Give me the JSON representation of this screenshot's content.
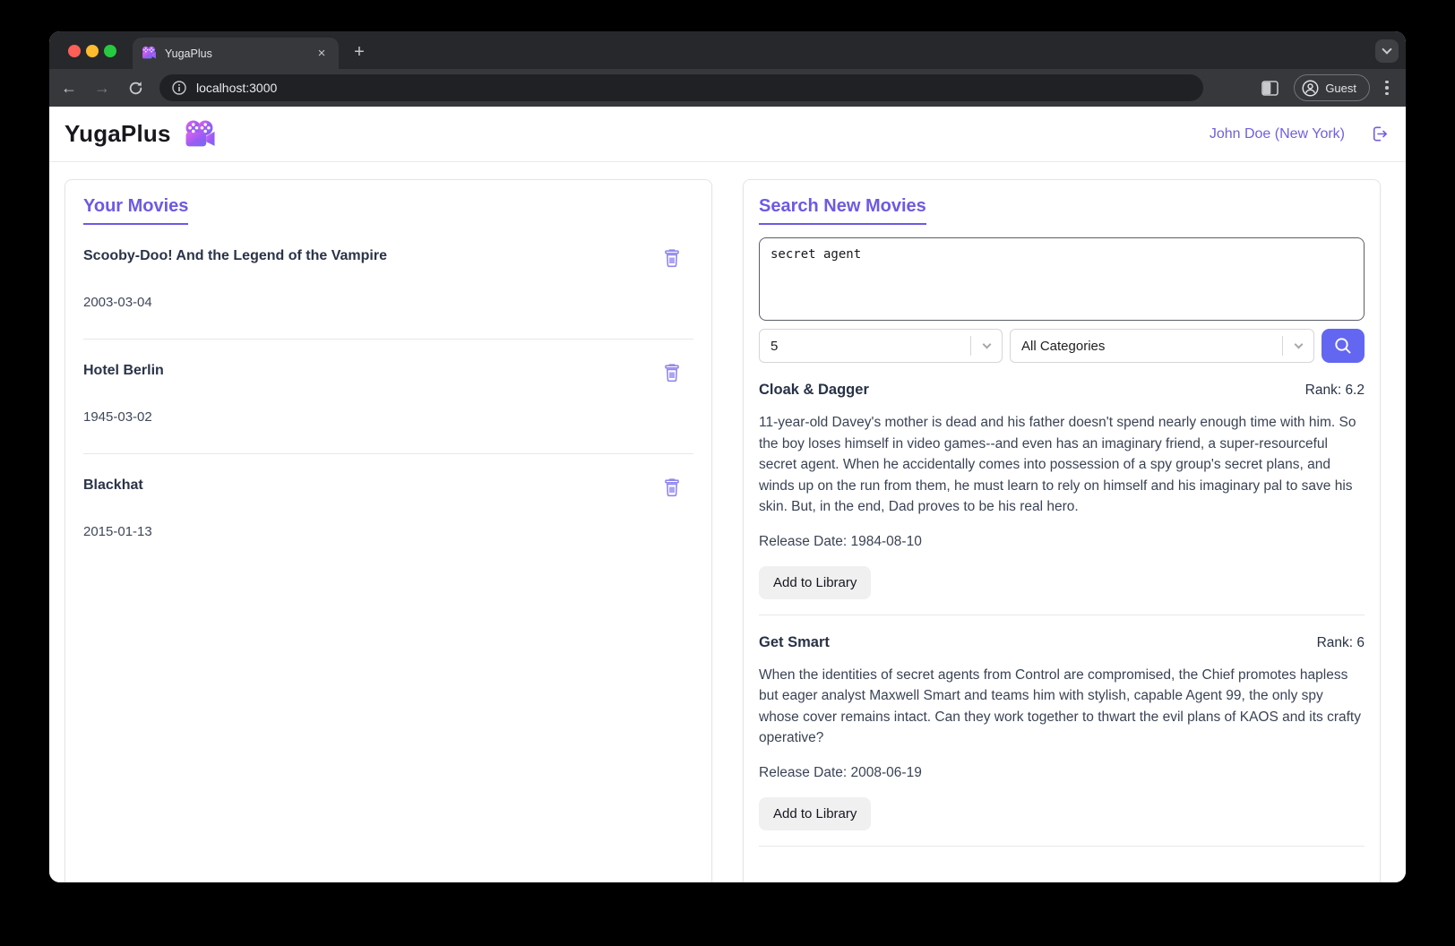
{
  "browser": {
    "tab_title": "YugaPlus",
    "close_tab_glyph": "×",
    "new_tab_glyph": "+",
    "back_glyph": "←",
    "forward_glyph": "→",
    "url": "localhost:3000",
    "profile_label": "Guest"
  },
  "header": {
    "brand": "YugaPlus",
    "user": "John Doe (New York)"
  },
  "library": {
    "title": "Your Movies",
    "movies": [
      {
        "title": "Scooby-Doo! And the Legend of the Vampire",
        "date": "2003-03-04"
      },
      {
        "title": "Hotel Berlin",
        "date": "1945-03-02"
      },
      {
        "title": "Blackhat",
        "date": "2015-01-13"
      }
    ]
  },
  "search": {
    "title": "Search New Movies",
    "query": "secret agent",
    "limit_value": "5",
    "category_value": "All Categories",
    "add_to_library_label": "Add to Library",
    "results": [
      {
        "title": "Cloak & Dagger",
        "rank_label": "Rank: 6.2",
        "description": "11-year-old Davey's mother is dead and his father doesn't spend nearly enough time with him. So the boy loses himself in video games--and even has an imaginary friend, a super-resourceful secret agent. When he accidentally comes into possession of a spy group's secret plans, and winds up on the run from them, he must learn to rely on himself and his imaginary pal to save his skin. But, in the end, Dad proves to be his real hero.",
        "release_label": "Release Date: 1984-08-10"
      },
      {
        "title": "Get Smart",
        "rank_label": "Rank: 6",
        "description": "When the identities of secret agents from Control are compromised, the Chief promotes hapless but eager analyst Maxwell Smart and teams him with stylish, capable Agent 99, the only spy whose cover remains intact. Can they work together to thwart the evil plans of KAOS and its crafty operative?",
        "release_label": "Release Date: 2008-06-19"
      }
    ]
  },
  "colors": {
    "accent_purple": "#6c5ae4",
    "search_button": "#6366f1",
    "traffic_red": "#ff5f57",
    "traffic_yellow": "#febc2e",
    "traffic_green": "#28c840"
  }
}
